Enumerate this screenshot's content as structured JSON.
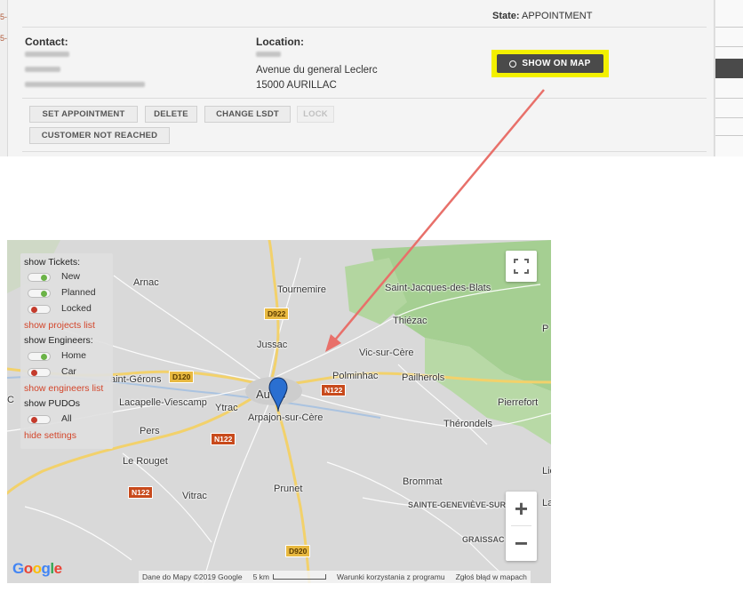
{
  "left_strip": {
    "marks": [
      "5-",
      "5-"
    ]
  },
  "ticket": {
    "state_label": "State:",
    "state_value": "APPOINTMENT",
    "contact_title": "Contact:",
    "location_title": "Location:",
    "address_line1": "Avenue du general Leclerc",
    "address_line2": "15000 AURILLAC",
    "show_on_map": "SHOW ON MAP",
    "actions": {
      "set_appointment": "SET APPOINTMENT",
      "delete": "DELETE",
      "change_lsdt": "CHANGE LSDT",
      "lock": "LOCK",
      "customer_not_reached": "CUSTOMER NOT REACHED"
    },
    "highlight_color": "#f3f000"
  },
  "map": {
    "settings": {
      "tickets_heading": "show Tickets:",
      "ticket_toggles": [
        {
          "label": "New",
          "state": "on"
        },
        {
          "label": "Planned",
          "state": "on"
        },
        {
          "label": "Locked",
          "state": "off"
        }
      ],
      "projects_link": "show projects list",
      "engineers_heading": "show Engineers:",
      "engineer_toggles": [
        {
          "label": "Home",
          "state": "on"
        },
        {
          "label": "Car",
          "state": "off"
        }
      ],
      "engineers_link": "show engineers list",
      "pudos_heading": "show PUDOs",
      "pudo_toggles": [
        {
          "label": "All",
          "state": "off"
        }
      ],
      "hide_link": "hide settings"
    },
    "places": {
      "arnac": "Arnac",
      "tournemire": "Tournemire",
      "saint_jacques": "Saint-Jacques-des-Blats",
      "thiezac": "Thiézac",
      "jussac": "Jussac",
      "vic": "Vic-sur-Cère",
      "polminhac": "Polminhac",
      "pailherols": "Pailherols",
      "saint_gerons": "aint-Gérons",
      "aurillac": "Au     ac",
      "lacapelle": "Lacapelle-Viescamp",
      "ytrac": "Ytrac",
      "arpajon": "Arpajon-sur-Cère",
      "pierrefort": "Pierrefort",
      "therondels": "Thérondels",
      "pers": "Pers",
      "le_rouget": "Le Rouget",
      "vitrac": "Vitrac",
      "prunet": "Prunet",
      "brommat": "Brommat",
      "sainte_genevieve": "SAINTE-GENEVIÈVE-SUR-AR",
      "graissac": "GRAISSAC",
      "edge_p": "P",
      "edge_c": "C",
      "edge_lie": "Lie",
      "edge_lac": "Lac"
    },
    "roads": {
      "d922": "D922",
      "d120": "D120",
      "n122_east": "N122",
      "n122_mid": "N122",
      "n122_south": "N122",
      "d920": "D920"
    },
    "zoom_in": "+",
    "zoom_out": "−",
    "google": [
      "G",
      "o",
      "o",
      "g",
      "l",
      "e"
    ],
    "footer": {
      "data": "Dane do Mapy ©2019 Google",
      "scale": "5 km",
      "terms": "Warunki korzystania z programu",
      "report": "Zgłoś błąd w mapach"
    },
    "colors": {
      "land": "#d9d9d9",
      "forest": "#a5cf92",
      "major_road": "#f2d16b",
      "minor_road": "#ffffff",
      "marker": "#2a6fd1"
    }
  }
}
